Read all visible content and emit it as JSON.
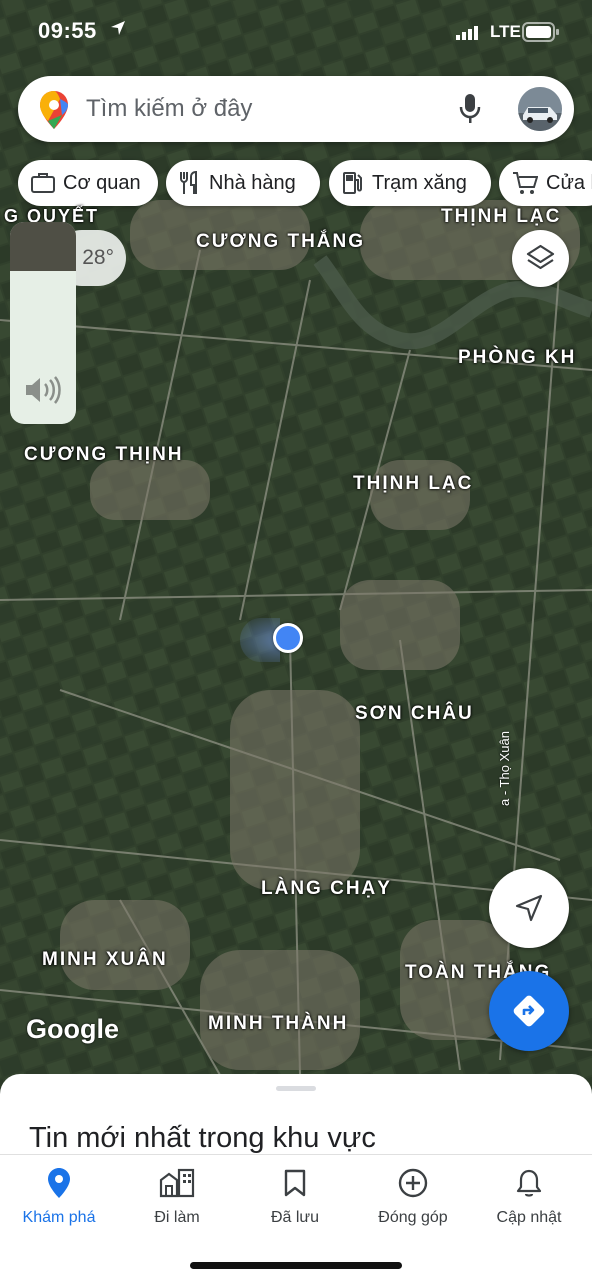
{
  "status_bar": {
    "time": "09:55",
    "network": "LTE"
  },
  "search": {
    "placeholder": "Tìm kiếm ở đây"
  },
  "chips": [
    {
      "label": "Cơ quan",
      "icon": "briefcase-icon"
    },
    {
      "label": "Nhà hàng",
      "icon": "restaurant-icon"
    },
    {
      "label": "Trạm xăng",
      "icon": "gas-station-icon"
    },
    {
      "label": "Cửa h",
      "icon": "cart-icon"
    }
  ],
  "map": {
    "temperature": "28°",
    "labels": [
      "G QUYẾT",
      "THỊNH LẠC",
      "CƯƠNG THẮNG",
      "PHÒNG KH",
      "CƯƠNG THỊNH",
      "THỊNH LẠC",
      "SƠN CHÂU",
      "LÀNG CHẠY",
      "MINH XUÂN",
      "TOÀN THẮNG",
      "MINH THÀNH"
    ],
    "road_label": "a - Thọ Xuân",
    "attribution": "Google"
  },
  "sheet": {
    "title": "Tin mới nhất trong khu vực"
  },
  "tabs": [
    {
      "label": "Khám phá",
      "icon": "explore-pin-icon",
      "active": true
    },
    {
      "label": "Đi làm",
      "icon": "commute-icon"
    },
    {
      "label": "Đã lưu",
      "icon": "bookmark-icon"
    },
    {
      "label": "Đóng góp",
      "icon": "add-circle-icon"
    },
    {
      "label": "Cập nhật",
      "icon": "bell-icon"
    }
  ],
  "colors": {
    "accent": "#1a73e8",
    "location_dot": "#4285f4"
  }
}
